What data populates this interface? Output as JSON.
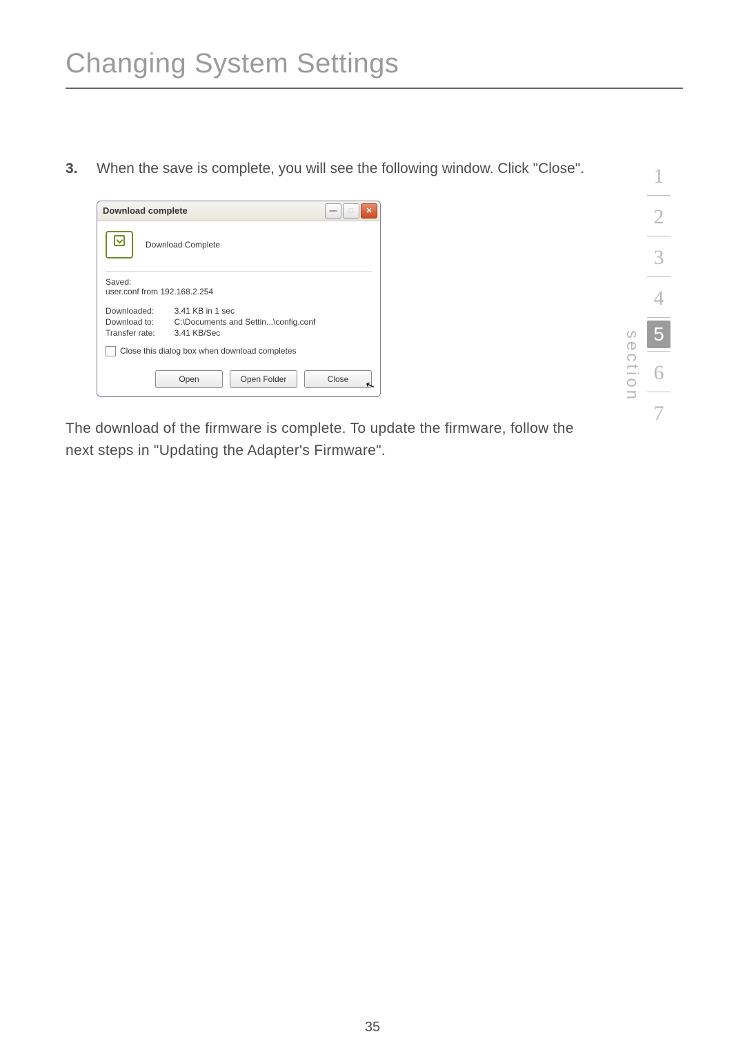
{
  "page_title": "Changing System Settings",
  "step": {
    "number": "3.",
    "text": "When the save is complete, you will see the following window. Click \"Close\"."
  },
  "dialog": {
    "title": "Download complete",
    "header_text": "Download Complete",
    "saved_label": "Saved:",
    "saved_value": "user.conf from 192.168.2.254",
    "rows": [
      {
        "label": "Downloaded:",
        "value": "3.41 KB in 1 sec"
      },
      {
        "label": "Download to:",
        "value": "C:\\Documents and Settin...\\config.conf"
      },
      {
        "label": "Transfer rate:",
        "value": "3.41 KB/Sec"
      }
    ],
    "checkbox_label": "Close this dialog box when download completes",
    "buttons": {
      "open": "Open",
      "open_folder": "Open Folder",
      "close": "Close"
    }
  },
  "after_text": "The download of the firmware is complete. To update the firmware, follow the next steps in \"Updating the Adapter's Firmware\".",
  "section_label": "section",
  "nav": [
    "1",
    "2",
    "3",
    "4",
    "5",
    "6",
    "7"
  ],
  "nav_active_index": 4,
  "page_number": "35"
}
